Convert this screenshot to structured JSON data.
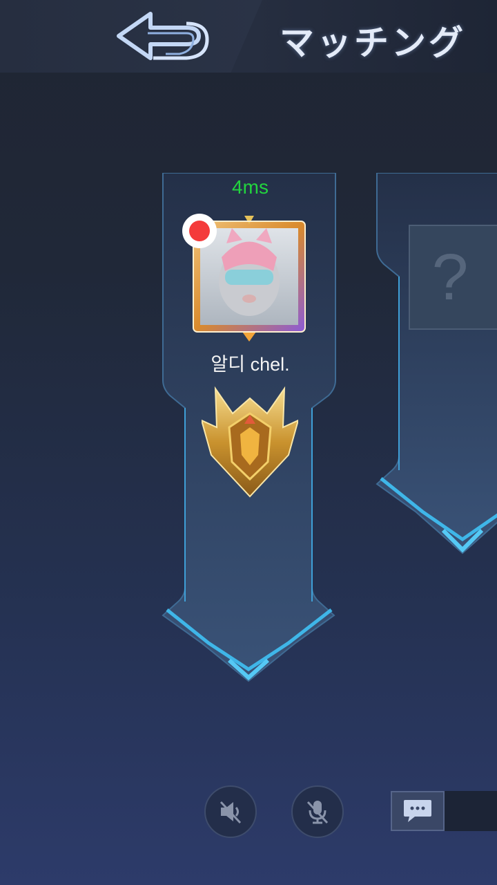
{
  "header": {
    "title": "マッチング",
    "back_icon": "back-arrow-icon"
  },
  "player": {
    "ping": "4ms",
    "name": "알디 chel.",
    "recording": true,
    "rank_icon": "mythic-rank-emblem-icon"
  },
  "opponent": {
    "placeholder": "?"
  },
  "controls": {
    "speaker_icon": "speaker-muted-icon",
    "mic_icon": "mic-muted-icon",
    "chat_icon": "chat-bubble-icon"
  },
  "colors": {
    "ping": "#22d43e",
    "record": "#f43b3b",
    "accent": "#3fb6e8"
  }
}
